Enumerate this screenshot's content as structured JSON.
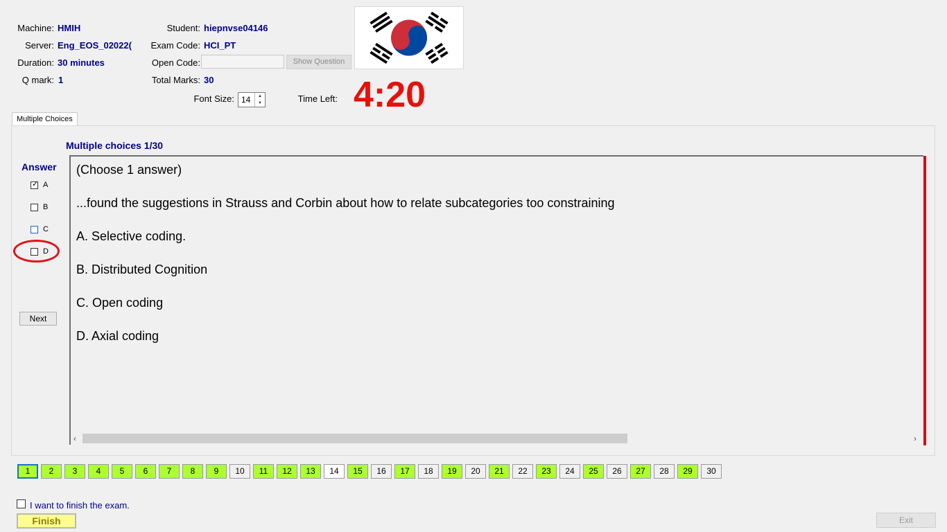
{
  "header": {
    "machine_label": "Machine:",
    "machine_value": "HMIH",
    "server_label": "Server:",
    "server_value": "Eng_EOS_02022(",
    "duration_label": "Duration:",
    "duration_value": "30 minutes",
    "qmark_label": "Q mark:",
    "qmark_value": "1",
    "student_label": "Student:",
    "student_value": "hiepnvse04146",
    "exam_code_label": "Exam Code:",
    "exam_code_value": "HCI_PT",
    "open_code_label": "Open Code:",
    "open_code_value": "",
    "show_question_label": "Show Question",
    "total_marks_label": "Total Marks:",
    "total_marks_value": "30",
    "font_size_label": "Font Size:",
    "font_size_value": "14",
    "time_left_label": "Time Left:",
    "time_left_value": "4:20"
  },
  "tabs": [
    {
      "label": "Multiple Choices",
      "active": true
    }
  ],
  "question": {
    "header": "Multiple choices 1/30",
    "lines": [
      "(Choose 1 answer)",
      "...found the suggestions in Strauss and Corbin about how to relate subcategories too constraining",
      "A.  Selective coding.",
      "B.  Distributed Cognition",
      "C.  Open coding",
      "D.  Axial coding"
    ]
  },
  "answer": {
    "title": "Answer",
    "options": [
      {
        "label": "A",
        "checked": true
      },
      {
        "label": "B",
        "checked": false
      },
      {
        "label": "C",
        "checked": false
      },
      {
        "label": "D",
        "checked": false
      }
    ],
    "next_label": "Next"
  },
  "navigation": {
    "questions": [
      {
        "label": "1",
        "state": "current"
      },
      {
        "label": "2",
        "state": "answered"
      },
      {
        "label": "3",
        "state": "answered"
      },
      {
        "label": "4",
        "state": "answered"
      },
      {
        "label": "5",
        "state": "answered"
      },
      {
        "label": "6",
        "state": "answered"
      },
      {
        "label": "7",
        "state": "answered"
      },
      {
        "label": "8",
        "state": "answered"
      },
      {
        "label": "9",
        "state": "answered"
      },
      {
        "label": "10",
        "state": "unanswered"
      },
      {
        "label": "11",
        "state": "answered"
      },
      {
        "label": "12",
        "state": "answered"
      },
      {
        "label": "13",
        "state": "answered"
      },
      {
        "label": "14",
        "state": "plain"
      },
      {
        "label": "15",
        "state": "answered"
      },
      {
        "label": "16",
        "state": "unanswered"
      },
      {
        "label": "17",
        "state": "answered"
      },
      {
        "label": "18",
        "state": "unanswered"
      },
      {
        "label": "19",
        "state": "answered"
      },
      {
        "label": "20",
        "state": "unanswered"
      },
      {
        "label": "21",
        "state": "answered"
      },
      {
        "label": "22",
        "state": "unanswered"
      },
      {
        "label": "23",
        "state": "answered"
      },
      {
        "label": "24",
        "state": "unanswered"
      },
      {
        "label": "25",
        "state": "answered"
      },
      {
        "label": "26",
        "state": "unanswered"
      },
      {
        "label": "27",
        "state": "answered"
      },
      {
        "label": "28",
        "state": "unanswered"
      },
      {
        "label": "29",
        "state": "answered"
      },
      {
        "label": "30",
        "state": "unanswered"
      }
    ]
  },
  "footer": {
    "finish_check_label": "I want to finish the exam.",
    "finish_checked": false,
    "finish_label": "Finish",
    "exit_label": "Exit"
  },
  "colors": {
    "accent_blue": "#00008b",
    "timer_red": "#e8100a",
    "answered_green": "#adff2f",
    "finish_yellow": "#ffff90",
    "flag_red": "#cd2e3a",
    "flag_blue": "#0047a0"
  },
  "icons": {
    "flag": "south-korea-flag-icon",
    "checkmark": "check-icon",
    "scroll_left": "chevron-left-icon",
    "scroll_right": "chevron-right-icon",
    "spin_up": "spin-up-icon",
    "spin_down": "spin-down-icon"
  }
}
